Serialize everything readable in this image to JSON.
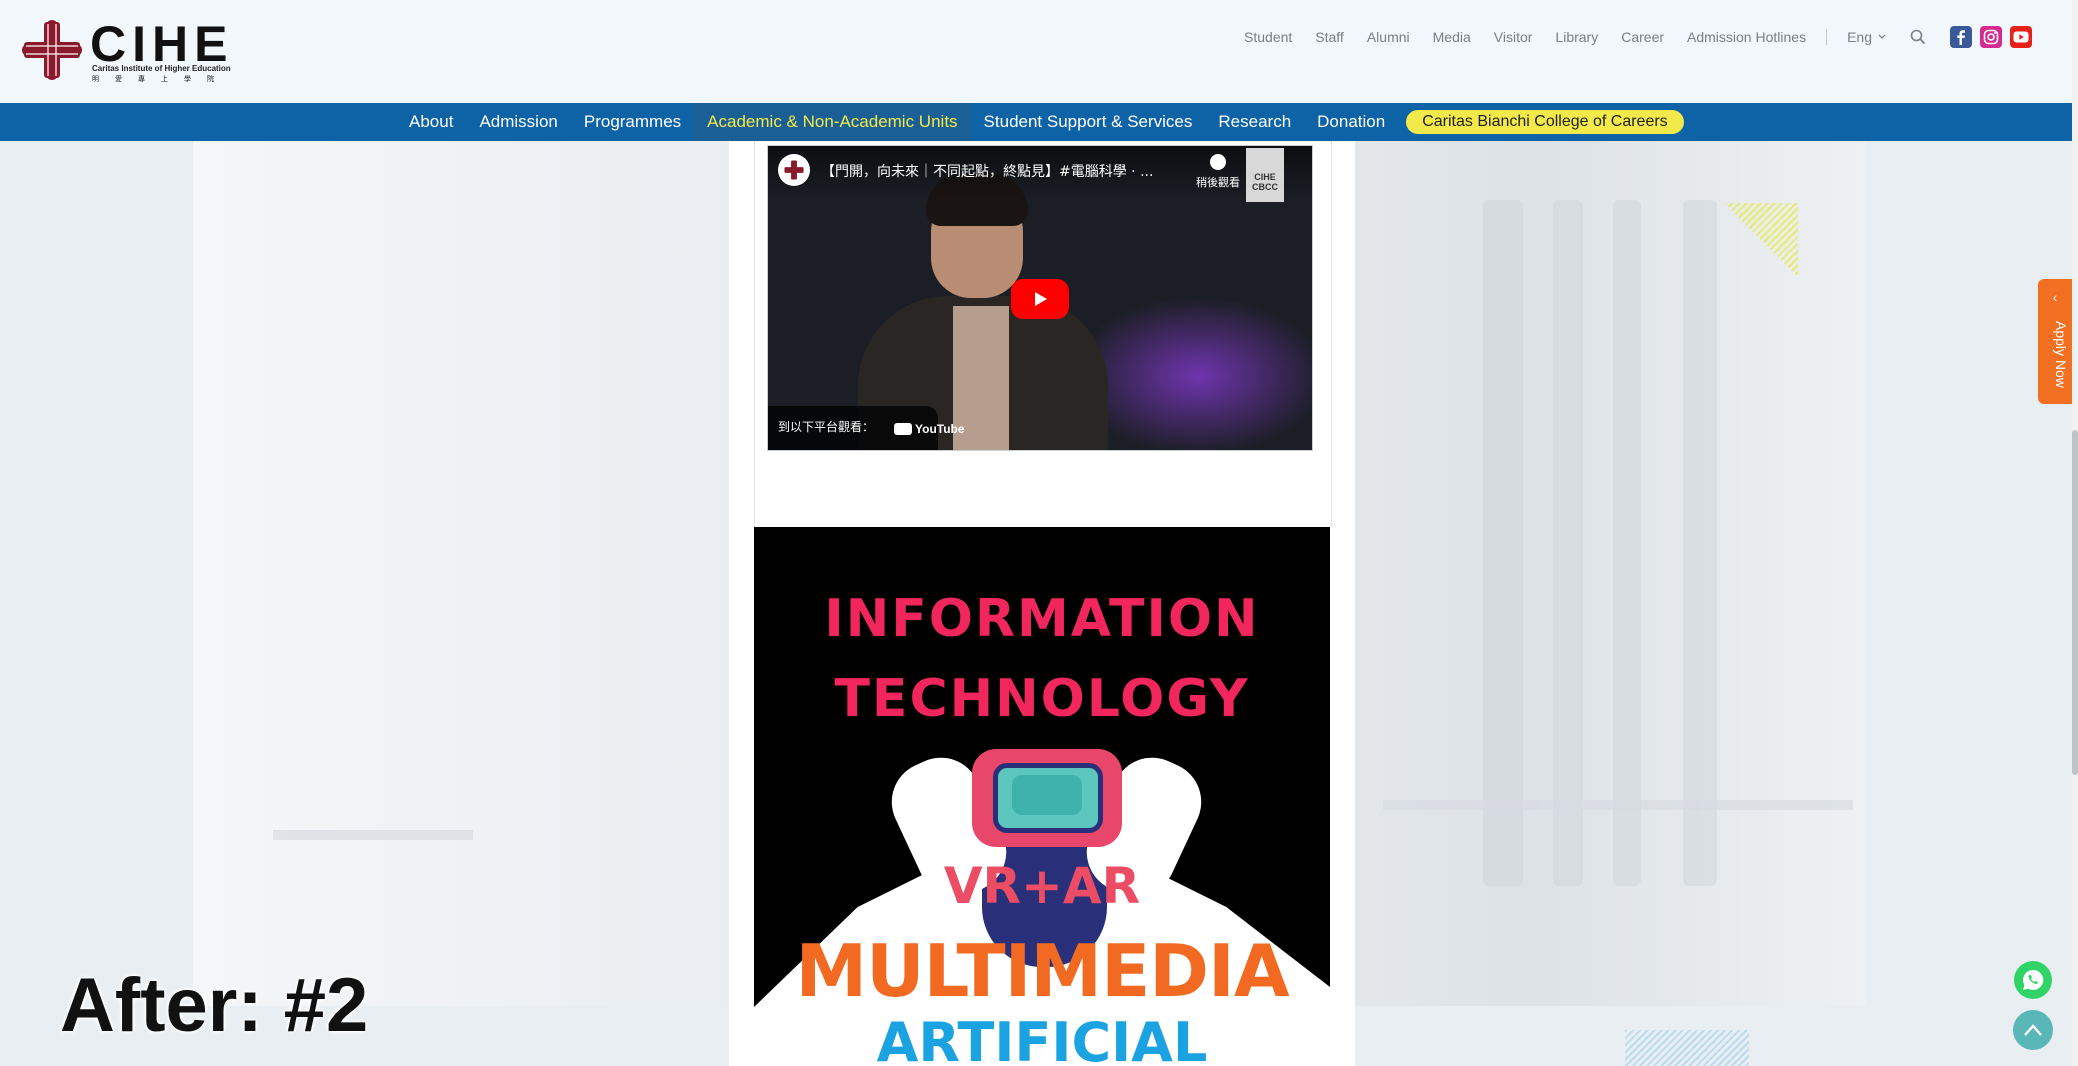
{
  "logo": {
    "wordmark": "CIHE",
    "subtitle": "Caritas Institute of Higher Education",
    "subtitle_zh": "明愛專上學院"
  },
  "topnav": {
    "links": [
      "Student",
      "Staff",
      "Alumni",
      "Media",
      "Visitor",
      "Library",
      "Career",
      "Admission Hotlines"
    ],
    "language": "Eng",
    "icons": [
      "search-icon",
      "facebook-icon",
      "instagram-icon",
      "youtube-icon"
    ]
  },
  "mainnav": {
    "items": [
      "About",
      "Admission",
      "Programmes",
      "Academic & Non-Academic Units",
      "Student Support & Services",
      "Research",
      "Donation"
    ],
    "active": "Academic & Non-Academic Units",
    "highlight": "Caritas Bianchi College of Careers"
  },
  "video": {
    "title": "【門開，向未來｜不同起點，終點見】#電腦科學 · ...",
    "watch_later": "稍後觀看",
    "watermark": "CIHE CBCC",
    "watch_on": "到以下平台觀看：",
    "platform": "YouTube"
  },
  "poster": {
    "line1": "INFORMATION",
    "line2": "TECHNOLOGY",
    "line3": "VR+AR",
    "line4": "MULTIMEDIA",
    "line5": "ARTIFICIAL"
  },
  "side": {
    "apply_now": "Apply Now"
  },
  "overlay": {
    "label": "After: #2"
  },
  "colors": {
    "nav_blue": "#0d63a5",
    "nav_active_text": "#f2e94a",
    "pill_yellow": "#f2e94a",
    "apply_orange": "#f36f21",
    "poster_pink": "#f0265c",
    "poster_orange": "#f26a21",
    "poster_blue": "#1aa3e0",
    "whatsapp_green": "#2fd366",
    "to_top_teal": "#5ab7b7"
  }
}
